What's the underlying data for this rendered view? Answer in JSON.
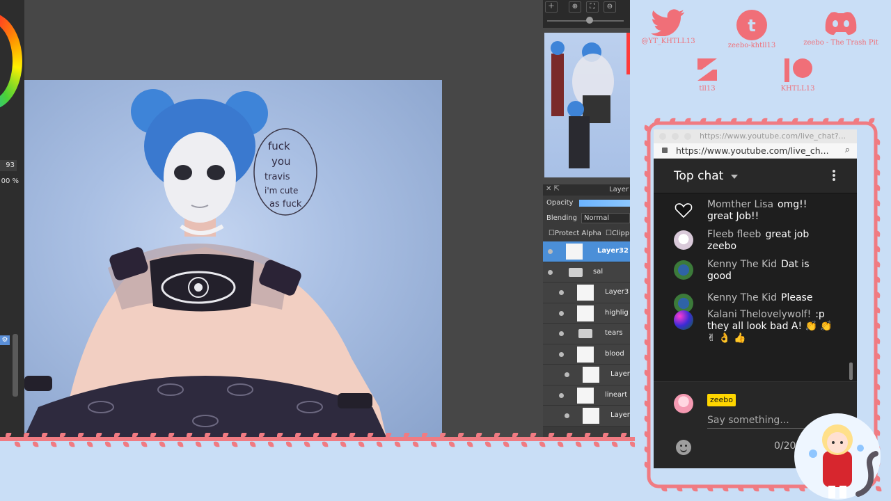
{
  "canvas": {
    "left_values": [
      "93",
      "00 %"
    ],
    "speech_bubble_lines": [
      "fuck",
      "you",
      "travis",
      "i'm cute",
      "as fuck"
    ]
  },
  "layers": {
    "panel_title": "Layer",
    "opacity_label": "Opacity",
    "blending_label": "Blending",
    "blending_value": "Normal",
    "protect_alpha": "Protect Alpha",
    "clipping": "Clipp",
    "items": [
      {
        "name": "Layer32",
        "kind": "layer",
        "indent": 0,
        "selected": true
      },
      {
        "name": "sal",
        "kind": "folder",
        "indent": 0,
        "selected": false
      },
      {
        "name": "Layer3",
        "kind": "layer",
        "indent": 1,
        "selected": false
      },
      {
        "name": "highlig",
        "kind": "layer",
        "indent": 1,
        "selected": false
      },
      {
        "name": "tears",
        "kind": "folder",
        "indent": 1,
        "selected": false
      },
      {
        "name": "blood",
        "kind": "layer",
        "indent": 1,
        "selected": false
      },
      {
        "name": "Layer",
        "kind": "layer",
        "indent": 2,
        "selected": false
      },
      {
        "name": "lineart",
        "kind": "layer",
        "indent": 1,
        "selected": false
      },
      {
        "name": "Layer",
        "kind": "layer",
        "indent": 2,
        "selected": false
      }
    ]
  },
  "socials": {
    "twitter": "@YT_KHTLL13",
    "tumblr": "zeebo-khtll13",
    "discord": "zeebo - The Trash Pit",
    "ko": "tll13",
    "patreon": "KHTLL13"
  },
  "browser": {
    "tab_url": "https://www.youtube.com/live_chat?...",
    "address_url": "https://www.youtube.com/live_ch..."
  },
  "chat": {
    "title": "Top chat",
    "messages": [
      {
        "author": "Momther Lisa",
        "text": "omg!! great Job!!",
        "avatar": "heart"
      },
      {
        "author": "Fleeb fleeb",
        "text": "great job zeebo",
        "avatar": "girl"
      },
      {
        "author": "Kenny The Kid",
        "text": "Dat is good",
        "avatar": "kh"
      },
      {
        "author": "Kenny The Kid",
        "text": "Please",
        "avatar": "kh"
      },
      {
        "author": "Kalani Thelovelywolf!",
        "text": ":p they all look bad A! 👏 👏 ✌ 👌 👍",
        "avatar": "galaxy"
      }
    ],
    "composer": {
      "username": "zeebo",
      "placeholder": "Say something...",
      "counter": "0/20"
    }
  },
  "colors": {
    "accent_pink": "#f06f78",
    "layer_selected": "#4b8fd8",
    "chat_bg": "#1e1e1e",
    "page_bg": "#c9def6"
  }
}
